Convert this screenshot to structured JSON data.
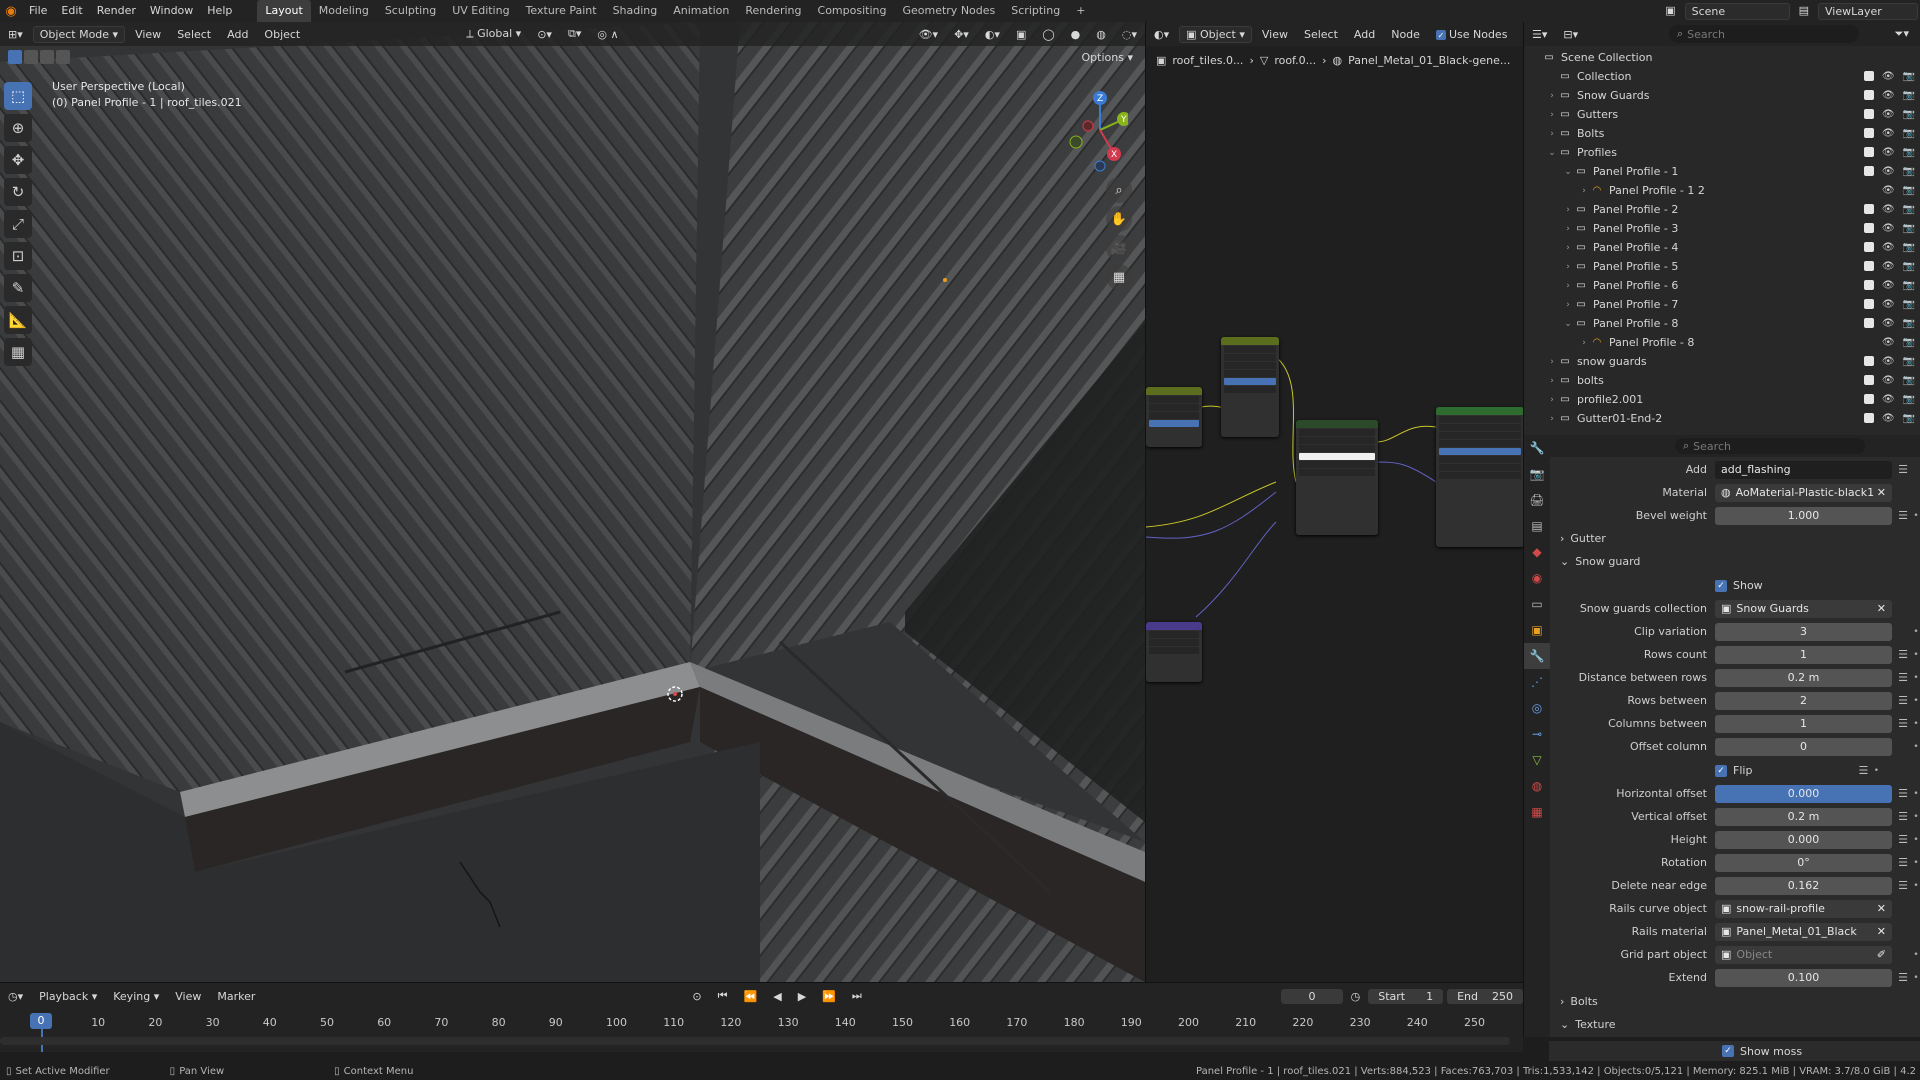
{
  "menu": {
    "items": [
      "File",
      "Edit",
      "Render",
      "Window",
      "Help"
    ],
    "workspaces": [
      "Layout",
      "Modeling",
      "Sculpting",
      "UV Editing",
      "Texture Paint",
      "Shading",
      "Animation",
      "Rendering",
      "Compositing",
      "Geometry Nodes",
      "Scripting"
    ],
    "active_workspace": "Layout",
    "scene": "Scene",
    "view_layer": "ViewLayer"
  },
  "viewport": {
    "mode": "Object Mode",
    "header_menus": [
      "View",
      "Select",
      "Add",
      "Object"
    ],
    "orientation": "Global",
    "options": "Options",
    "perspective_label": "User Perspective (Local)",
    "object_label": "(0) Panel Profile - 1 | roof_tiles.021"
  },
  "node_editor": {
    "mode": "Object",
    "menus": [
      "View",
      "Select",
      "Add",
      "Node"
    ],
    "use_nodes": "Use Nodes",
    "breadcrumb": [
      "roof_tiles.0...",
      "roof.0...",
      "Panel_Metal_01_Black-gene..."
    ]
  },
  "outliner": {
    "search_placeholder": "Search",
    "rows": [
      {
        "label": "Scene Collection",
        "indent": 0,
        "tri": ""
      },
      {
        "label": "Collection",
        "indent": 1,
        "tri": ""
      },
      {
        "label": "Snow Guards",
        "indent": 1,
        "tri": "›"
      },
      {
        "label": "Gutters",
        "indent": 1,
        "tri": "›"
      },
      {
        "label": "Bolts",
        "indent": 1,
        "tri": "›"
      },
      {
        "label": "Profiles",
        "indent": 1,
        "tri": "⌄"
      },
      {
        "label": "Panel Profile - 1",
        "indent": 2,
        "tri": "⌄"
      },
      {
        "label": "Panel Profile - 1 2",
        "indent": 3,
        "tri": "›"
      },
      {
        "label": "Panel Profile - 2",
        "indent": 2,
        "tri": "›"
      },
      {
        "label": "Panel Profile - 3",
        "indent": 2,
        "tri": "›"
      },
      {
        "label": "Panel Profile - 4",
        "indent": 2,
        "tri": "›"
      },
      {
        "label": "Panel Profile - 5",
        "indent": 2,
        "tri": "›"
      },
      {
        "label": "Panel Profile - 6",
        "indent": 2,
        "tri": "›"
      },
      {
        "label": "Panel Profile - 7",
        "indent": 2,
        "tri": "›"
      },
      {
        "label": "Panel Profile - 8",
        "indent": 2,
        "tri": "⌄"
      },
      {
        "label": "Panel Profile - 8",
        "indent": 3,
        "tri": "›"
      },
      {
        "label": "snow guards",
        "indent": 1,
        "tri": "›"
      },
      {
        "label": "bolts",
        "indent": 1,
        "tri": "›"
      },
      {
        "label": "profile2.001",
        "indent": 1,
        "tri": "›"
      },
      {
        "label": "Gutter01-End-2",
        "indent": 1,
        "tri": "›"
      }
    ]
  },
  "properties": {
    "search_placeholder": "Search",
    "add_label": "Add",
    "add_value": "add_flashing",
    "material_label": "Material",
    "material_value": "AoMaterial-Plastic-black1",
    "bevel_label": "Bevel weight",
    "bevel_value": "1.000",
    "gutter_section": "Gutter",
    "snow_section": "Snow guard",
    "show_label": "Show",
    "fields": [
      {
        "label": "Snow guards collection",
        "value": "Snow Guards",
        "type": "ref"
      },
      {
        "label": "Clip variation",
        "value": "3",
        "type": "num"
      },
      {
        "label": "Rows count",
        "value": "1",
        "type": "num"
      },
      {
        "label": "Distance between rows",
        "value": "0.2 m",
        "type": "num"
      },
      {
        "label": "Rows between",
        "value": "2",
        "type": "num"
      },
      {
        "label": "Columns between",
        "value": "1",
        "type": "num"
      },
      {
        "label": "Offset column",
        "value": "0",
        "type": "num"
      }
    ],
    "flip_label": "Flip",
    "fields2": [
      {
        "label": "Horizontal offset",
        "value": "0.000",
        "type": "active"
      },
      {
        "label": "Vertical offset",
        "value": "0.2 m",
        "type": "num"
      },
      {
        "label": "Height",
        "value": "0.000",
        "type": "num"
      },
      {
        "label": "Rotation",
        "value": "0°",
        "type": "num"
      },
      {
        "label": "Delete near edge",
        "value": "0.162",
        "type": "num"
      },
      {
        "label": "Rails curve object",
        "value": "snow-rail-profile",
        "type": "ref"
      },
      {
        "label": "Rails material",
        "value": "Panel_Metal_01_Black",
        "type": "ref"
      },
      {
        "label": "Grid part object",
        "value": "Object",
        "type": "placeholder"
      },
      {
        "label": "Extend",
        "value": "0.100",
        "type": "num"
      }
    ],
    "bolts_section": "Bolts",
    "texture_section": "Texture",
    "show_moss": "Show moss"
  },
  "timeline": {
    "menus": [
      "Playback",
      "Keying",
      "View",
      "Marker"
    ],
    "current_frame": "0",
    "start_label": "Start",
    "start": "1",
    "end_label": "End",
    "end": "250",
    "ticks": [
      "0",
      "10",
      "20",
      "30",
      "40",
      "50",
      "60",
      "70",
      "80",
      "90",
      "100",
      "110",
      "120",
      "130",
      "140",
      "150",
      "160",
      "170",
      "180",
      "190",
      "200",
      "210",
      "220",
      "230",
      "240",
      "250"
    ]
  },
  "status": {
    "left1": "Set Active Modifier",
    "left2": "Pan View",
    "left3": "Context Menu",
    "right": "Panel Profile - 1 | roof_tiles.021 | Verts:884,523 | Faces:763,703 | Tris:1,533,142 | Objects:0/5,121 | Memory: 825.1 MiB | VRAM: 3.7/8.0 GiB | 4.2"
  },
  "colors": {
    "accent": "#4772b3",
    "orange": "#e87d0d",
    "bg": "#1d1d1d"
  }
}
